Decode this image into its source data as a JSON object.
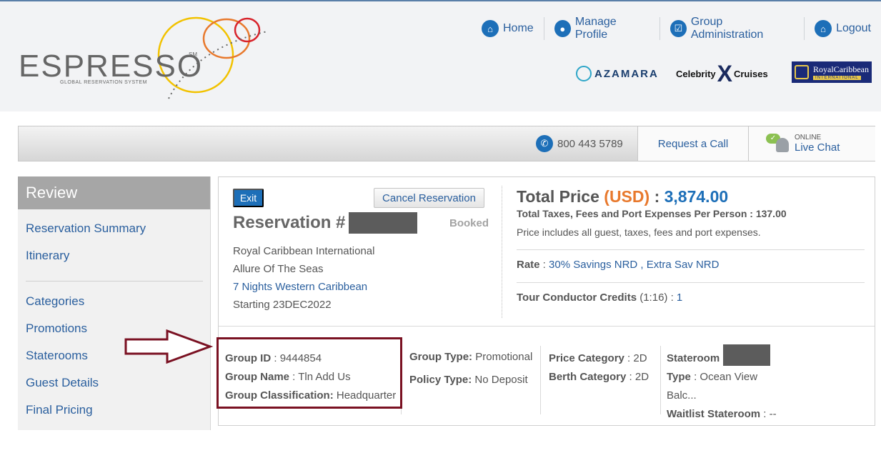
{
  "logo": {
    "name": "ESPRESSO",
    "tm": "SM",
    "tagline": "GLOBAL RESERVATION SYSTEM"
  },
  "nav": {
    "home": "Home",
    "manage_profile": "Manage Profile",
    "group_admin": "Group Administration",
    "logout": "Logout"
  },
  "brands": {
    "azamara": "AZAMARA",
    "celebrity_a": "Celebrity",
    "celebrity_x": "X",
    "celebrity_b": "Cruises",
    "royal": "RoyalCaribbean",
    "royal_sub": "INTERNATIONAL"
  },
  "contact": {
    "phone": "800 443 5789",
    "request_call": "Request a Call",
    "online": "ONLINE",
    "live_chat": "Live Chat"
  },
  "sidebar": {
    "title": "Review",
    "items": [
      "Reservation Summary",
      "Itinerary",
      "Categories",
      "Promotions",
      "Staterooms",
      "Guest Details",
      "Final Pricing"
    ]
  },
  "reservation": {
    "exit": "Exit",
    "cancel": "Cancel Reservation",
    "label": "Reservation # :",
    "status": "Booked",
    "line": "Royal Caribbean International",
    "ship": "Allure Of The Seas",
    "itinerary": "7 Nights Western Caribbean",
    "starting": "Starting 23DEC2022"
  },
  "pricing": {
    "total_label": "Total Price",
    "currency": "(USD)",
    "sep": ":",
    "total_amount": "3,874.00",
    "taxes": "Total Taxes, Fees and Port Expenses Per Person : 137.00",
    "includes": "Price includes all guest, taxes, fees and port expenses.",
    "rate_label": "Rate",
    "rate_value_1": "30% Savings NRD",
    "rate_value_2": ", Extra Sav NRD",
    "tcc_label": "Tour Conductor Credits",
    "tcc_ratio": "(1:16)",
    "tcc_value": "1"
  },
  "group": {
    "id_label": "Group ID",
    "id": "9444854",
    "name_label": "Group Name",
    "name": "Tln Add Us",
    "class_label": "Group Classification:",
    "class": "Headquarter",
    "type_label": "Group Type:",
    "type": "Promotional",
    "policy_label": "Policy Type:",
    "policy": "No Deposit",
    "price_cat_label": "Price Category",
    "price_cat": "2D",
    "berth_cat_label": "Berth Category",
    "berth_cat": "2D",
    "stateroom_label": "Stateroom",
    "st_type_label": "Type",
    "st_type": "Ocean View",
    "st_type_2": "Balc...",
    "waitlist_label": "Waitlist Stateroom",
    "waitlist": "--"
  },
  "colors": {
    "accent_blue": "#1d6fb8",
    "link_blue": "#2a5f9e",
    "currency_orange": "#e8792d",
    "highlight_maroon": "#7a1122"
  }
}
